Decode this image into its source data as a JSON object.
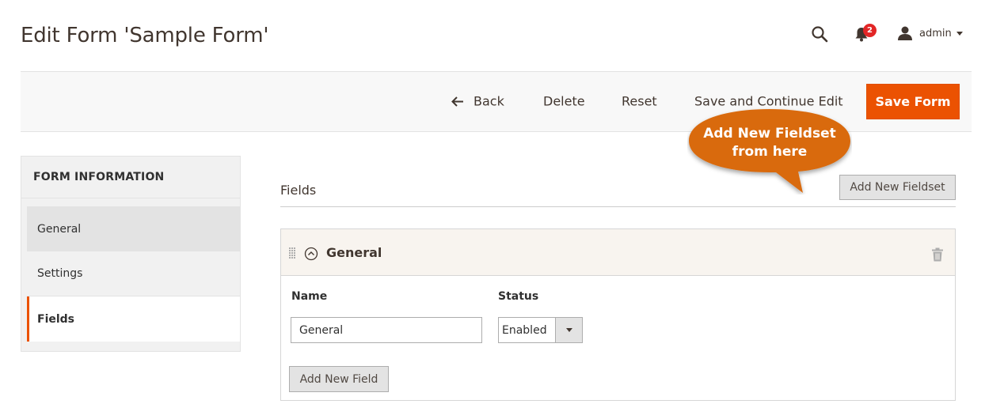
{
  "header": {
    "title": "Edit Form 'Sample Form'",
    "notifications_count": "2",
    "user_name": "admin"
  },
  "toolbar": {
    "back_label": "Back",
    "delete_label": "Delete",
    "reset_label": "Reset",
    "save_continue_label": "Save and Continue Edit",
    "save_label": "Save Form"
  },
  "callout": {
    "line1": "Add New Fieldset",
    "line2": "from here"
  },
  "sidebar": {
    "title": "FORM INFORMATION",
    "items": [
      {
        "label": "General"
      },
      {
        "label": "Settings"
      },
      {
        "label": "Fields"
      }
    ]
  },
  "fields": {
    "heading": "Fields",
    "add_fieldset_label": "Add New Fieldset",
    "fieldset": {
      "title": "General",
      "name_label": "Name",
      "status_label": "Status",
      "name_value": "General",
      "status_value": "Enabled",
      "add_field_label": "Add New Field"
    }
  },
  "colors": {
    "accent": "#eb5202",
    "callout": "#d96a0e",
    "badge": "#e22626"
  },
  "icons": [
    "search-icon",
    "bell-icon",
    "user-icon",
    "back-arrow-icon",
    "drag-handle-icon",
    "collapse-icon",
    "trash-icon",
    "chevron-down-icon"
  ]
}
